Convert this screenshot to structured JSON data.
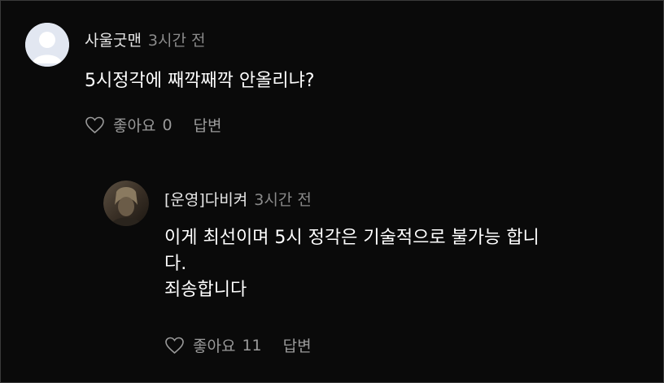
{
  "comments": [
    {
      "author": "사울굿맨",
      "time": "3시간 전",
      "body": [
        "5시정각에 째깍째깍 안올리냐?"
      ],
      "like_label": "좋아요",
      "like_count": "0",
      "reply_label": "답변",
      "avatar_icon": "default-user-avatar"
    }
  ],
  "reply": {
    "author": "[운영]다비켜",
    "time": "3시간 전",
    "body": [
      "이게 최선이며 5시 정각은 기술적으로 불가능 합니",
      "다.",
      "죄송합니다"
    ],
    "like_label": "좋아요",
    "like_count": "11",
    "reply_label": "답변",
    "avatar_icon": "profile-photo"
  },
  "colors": {
    "background": "#0a0a0a",
    "text_primary": "#ffffff",
    "text_secondary": "#8a8a8a"
  }
}
